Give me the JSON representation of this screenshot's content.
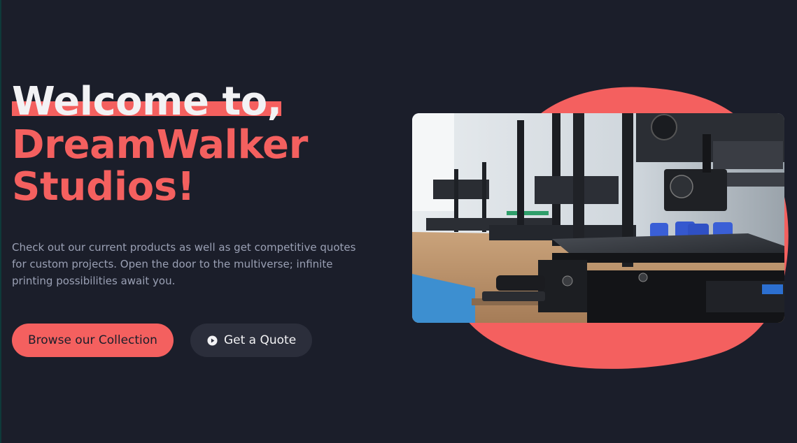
{
  "hero": {
    "title_line1": "Welcome to,",
    "title_line2": "DreamWalker",
    "title_line3": "Studios!",
    "description": "Check out our current products as well as get competitive quotes for custom projects. Open the door to the multiverse; infinite printing possibilities await you."
  },
  "buttons": {
    "primary_label": "Browse our Collection",
    "secondary_label": "Get a Quote",
    "secondary_icon": "play-circle-icon"
  },
  "colors": {
    "background": "#1b1e2a",
    "accent": "#f4605f",
    "text_light": "#f2f2f4",
    "text_muted": "#9aa0b4",
    "secondary_button": "#2b2e3b"
  }
}
